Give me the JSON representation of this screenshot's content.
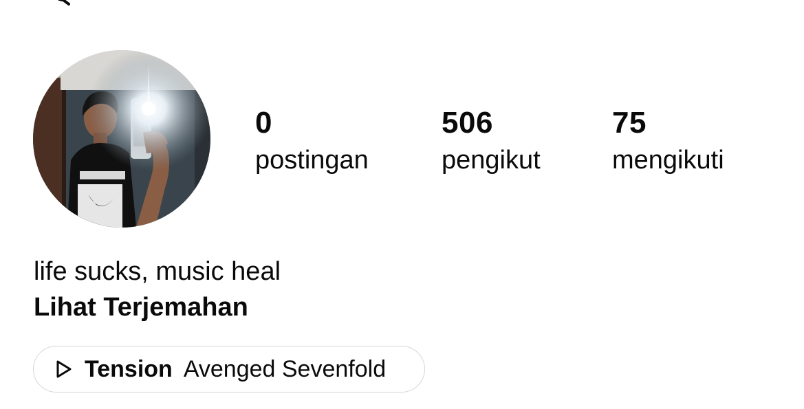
{
  "profile": {
    "avatar_alt": "profile photo",
    "stats": [
      {
        "value": "0",
        "label": "postingan"
      },
      {
        "value": "506",
        "label": "pengikut"
      },
      {
        "value": "75",
        "label": "mengikuti"
      }
    ],
    "bio": "life sucks, music heal",
    "translate_label": "Lihat Terjemahan",
    "music": {
      "song": "Tension",
      "artist": "Avenged Sevenfold"
    }
  },
  "icons": {
    "top_left": "search-icon",
    "top_right": "menu-icon",
    "music": "play-icon"
  }
}
